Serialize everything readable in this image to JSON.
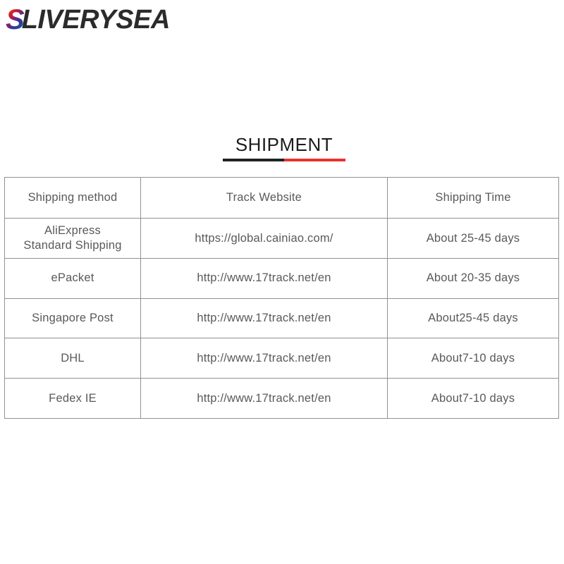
{
  "logo": {
    "initial": "S",
    "rest": "LIVERYSEA",
    "initial_gradient_colors": [
      "#f0a020",
      "#e8541f",
      "#d62027",
      "#9b1f5e",
      "#4c2f8f",
      "#2b3f93",
      "#1f5fa8",
      "#7a2a8c"
    ],
    "text_color": "#2b2b2b"
  },
  "section": {
    "title": "SHIPMENT",
    "rule_left_color": "#1f2326",
    "rule_right_color": "#e8322e"
  },
  "table": {
    "headers": [
      "Shipping method",
      "Track Website",
      "Shipping Time"
    ],
    "rows": [
      {
        "method": "AliExpress\nStandard Shipping",
        "site": "https://global.cainiao.com/",
        "time": "About 25-45 days"
      },
      {
        "method": "ePacket",
        "site": "http://www.17track.net/en",
        "time": "About 20-35 days"
      },
      {
        "method": "Singapore Post",
        "site": "http://www.17track.net/en",
        "time": "About25-45 days"
      },
      {
        "method": "DHL",
        "site": "http://www.17track.net/en",
        "time": "About7-10 days"
      },
      {
        "method": "Fedex IE",
        "site": "http://www.17track.net/en",
        "time": "About7-10 days"
      }
    ],
    "border_color": "#8e9194",
    "text_color": "#58595b"
  }
}
